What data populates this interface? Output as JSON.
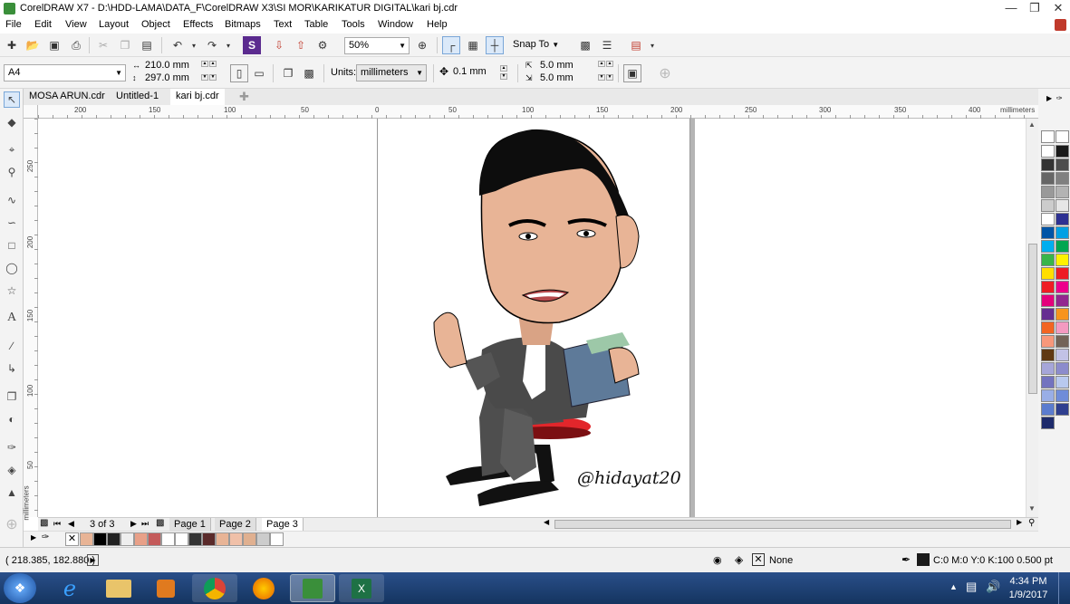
{
  "window": {
    "title": "CorelDRAW X7 - D:\\HDD-LAMA\\DATA_F\\CorelDRAW X3\\SI MOR\\KARIKATUR DIGITAL\\kari bj.cdr",
    "minimize_icon": "minimize-icon",
    "maximize_icon": "restore-icon",
    "close_icon": "close-icon"
  },
  "menu": [
    "File",
    "Edit",
    "View",
    "Layout",
    "Object",
    "Effects",
    "Bitmaps",
    "Text",
    "Table",
    "Tools",
    "Window",
    "Help"
  ],
  "toolbar": {
    "zoom_value": "50%",
    "snap_label": "Snap To"
  },
  "property_bar": {
    "paper_size": "A4",
    "width": "210.0 mm",
    "height": "297.0 mm",
    "units_label": "Units:",
    "units_value": "millimeters",
    "nudge": "0.1 mm",
    "dup_x": "5.0 mm",
    "dup_y": "5.0 mm"
  },
  "doc_tabs": [
    {
      "label": "MOSA ARUN.cdr",
      "active": false
    },
    {
      "label": "Untitled-1",
      "active": false
    },
    {
      "label": "kari bj.cdr",
      "active": true
    }
  ],
  "ruler": {
    "unit": "millimeters",
    "h_ticks": [
      "200",
      "150",
      "100",
      "50",
      "0",
      "50",
      "100",
      "150",
      "200",
      "250",
      "300",
      "350",
      "400"
    ],
    "v_ticks": [
      "250",
      "200",
      "150",
      "100",
      "50"
    ],
    "v_unit": "millimeters"
  },
  "canvas": {
    "watermark": "@hidayat20"
  },
  "pages": {
    "counter": "3 of 3",
    "tabs": [
      "Page 1",
      "Page 2",
      "Page 3"
    ],
    "active": "Page 3"
  },
  "status": {
    "coords": "( 218.385, 182.880 )",
    "fill_label": "None",
    "outline": "C:0 M:0 Y:0 K:100  0.500 pt"
  },
  "taskbar": {
    "time": "4:34 PM",
    "date": "1/9/2017"
  },
  "colors": {
    "palette": [
      "#ffffff",
      "#1a1a1a",
      "#333333",
      "#4d4d4d",
      "#666666",
      "#808080",
      "#999999",
      "#b3b3b3",
      "#cccccc",
      "#e6e6e6",
      "#ffffff",
      "#2e3192",
      "#0054a6",
      "#00a0e3",
      "#00aeef",
      "#00a651",
      "#39b54a",
      "#fff200",
      "#ffde00",
      "#ed1c24",
      "#ee1d24",
      "#ec008c",
      "#e4007c",
      "#92278f",
      "#662d91",
      "#f7941d",
      "#f26522",
      "#f49ac1",
      "#f7977a",
      "#736357",
      "#603913",
      "#c2c2e6",
      "#a6a6d9",
      "#8c8ccc",
      "#7373bf",
      "#b8c9ef",
      "#99aee6",
      "#6f8cd9",
      "#5b7ccf",
      "#2f3f8f",
      "#1d2a6b"
    ],
    "doc_palette": [
      "#e8b496",
      "#000000",
      "#222222",
      "#eeeeee",
      "#e8a088",
      "#c45a5a",
      "#ffffff",
      "#ffffff",
      "#333333",
      "#5a2a2a",
      "#e8b496",
      "#f0c0a8",
      "#e0b090",
      "#cccccc",
      "#ffffff"
    ]
  }
}
